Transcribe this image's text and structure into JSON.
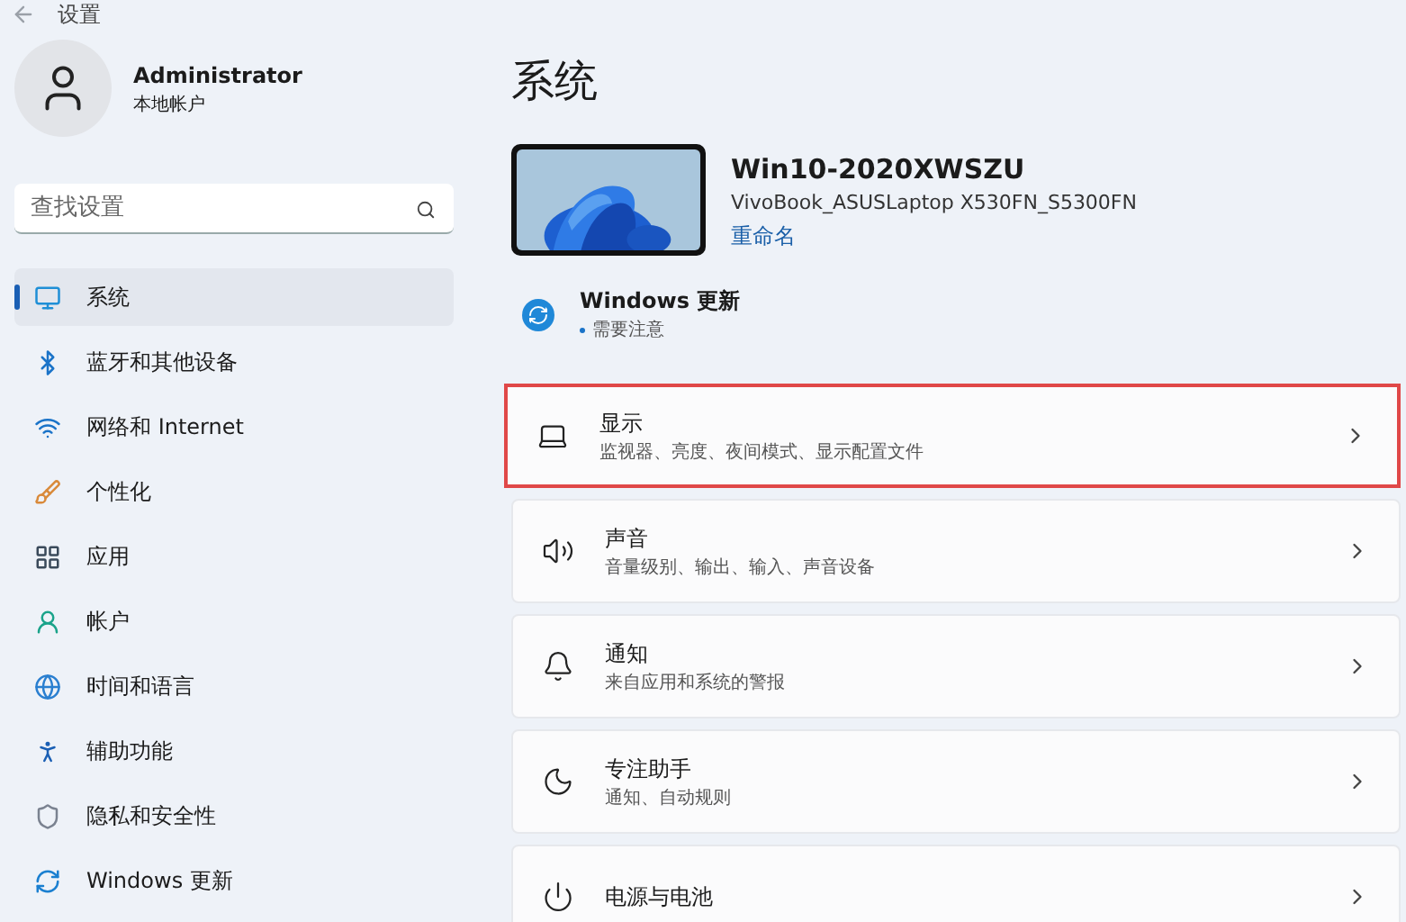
{
  "window": {
    "title": "设置"
  },
  "account": {
    "name": "Administrator",
    "type": "本地帐户"
  },
  "search": {
    "placeholder": "查找设置"
  },
  "sidebar": {
    "items": [
      {
        "label": "系统",
        "kind": "system",
        "selected": true
      },
      {
        "label": "蓝牙和其他设备",
        "kind": "bluetooth",
        "selected": false
      },
      {
        "label": "网络和 Internet",
        "kind": "network",
        "selected": false
      },
      {
        "label": "个性化",
        "kind": "personalize",
        "selected": false
      },
      {
        "label": "应用",
        "kind": "apps",
        "selected": false
      },
      {
        "label": "帐户",
        "kind": "account",
        "selected": false
      },
      {
        "label": "时间和语言",
        "kind": "time",
        "selected": false
      },
      {
        "label": "辅助功能",
        "kind": "accessibility",
        "selected": false
      },
      {
        "label": "隐私和安全性",
        "kind": "privacy",
        "selected": false
      },
      {
        "label": "Windows 更新",
        "kind": "update",
        "selected": false
      }
    ]
  },
  "page": {
    "title": "系统",
    "device": {
      "name": "Win10-2020XWSZU",
      "model": "VivoBook_ASUSLaptop X530FN_S5300FN",
      "rename": "重命名"
    },
    "update": {
      "title": "Windows 更新",
      "status": "需要注意"
    },
    "cards": [
      {
        "title": "显示",
        "subtitle": "监视器、亮度、夜间模式、显示配置文件",
        "kind": "display",
        "highlighted": true
      },
      {
        "title": "声音",
        "subtitle": "音量级别、输出、输入、声音设备",
        "kind": "sound",
        "highlighted": false
      },
      {
        "title": "通知",
        "subtitle": "来自应用和系统的警报",
        "kind": "notifications",
        "highlighted": false
      },
      {
        "title": "专注助手",
        "subtitle": "通知、自动规则",
        "kind": "focus",
        "highlighted": false
      },
      {
        "title": "电源与电池",
        "kind": "power",
        "highlighted": false
      }
    ]
  }
}
